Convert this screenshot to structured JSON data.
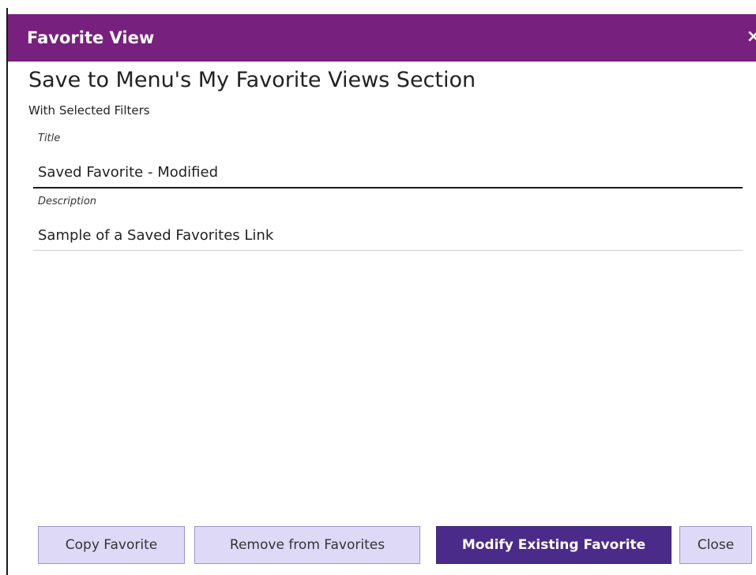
{
  "dialog": {
    "title": "Favorite View",
    "close_glyph": "×",
    "heading": "Save to Menu's My Favorite Views Section",
    "subheading": "With Selected Filters"
  },
  "form": {
    "title_label": "Title",
    "title_value": "Saved Favorite - Modified",
    "description_label": "Description",
    "description_value": "Sample of a Saved Favorites Link"
  },
  "buttons": {
    "copy": "Copy Favorite",
    "remove": "Remove from Favorites",
    "modify": "Modify Existing Favorite",
    "close": "Close"
  },
  "colors": {
    "titlebar": "#77207d",
    "primary_button": "#4a2b8a",
    "secondary_button": "#ddd9f7"
  }
}
